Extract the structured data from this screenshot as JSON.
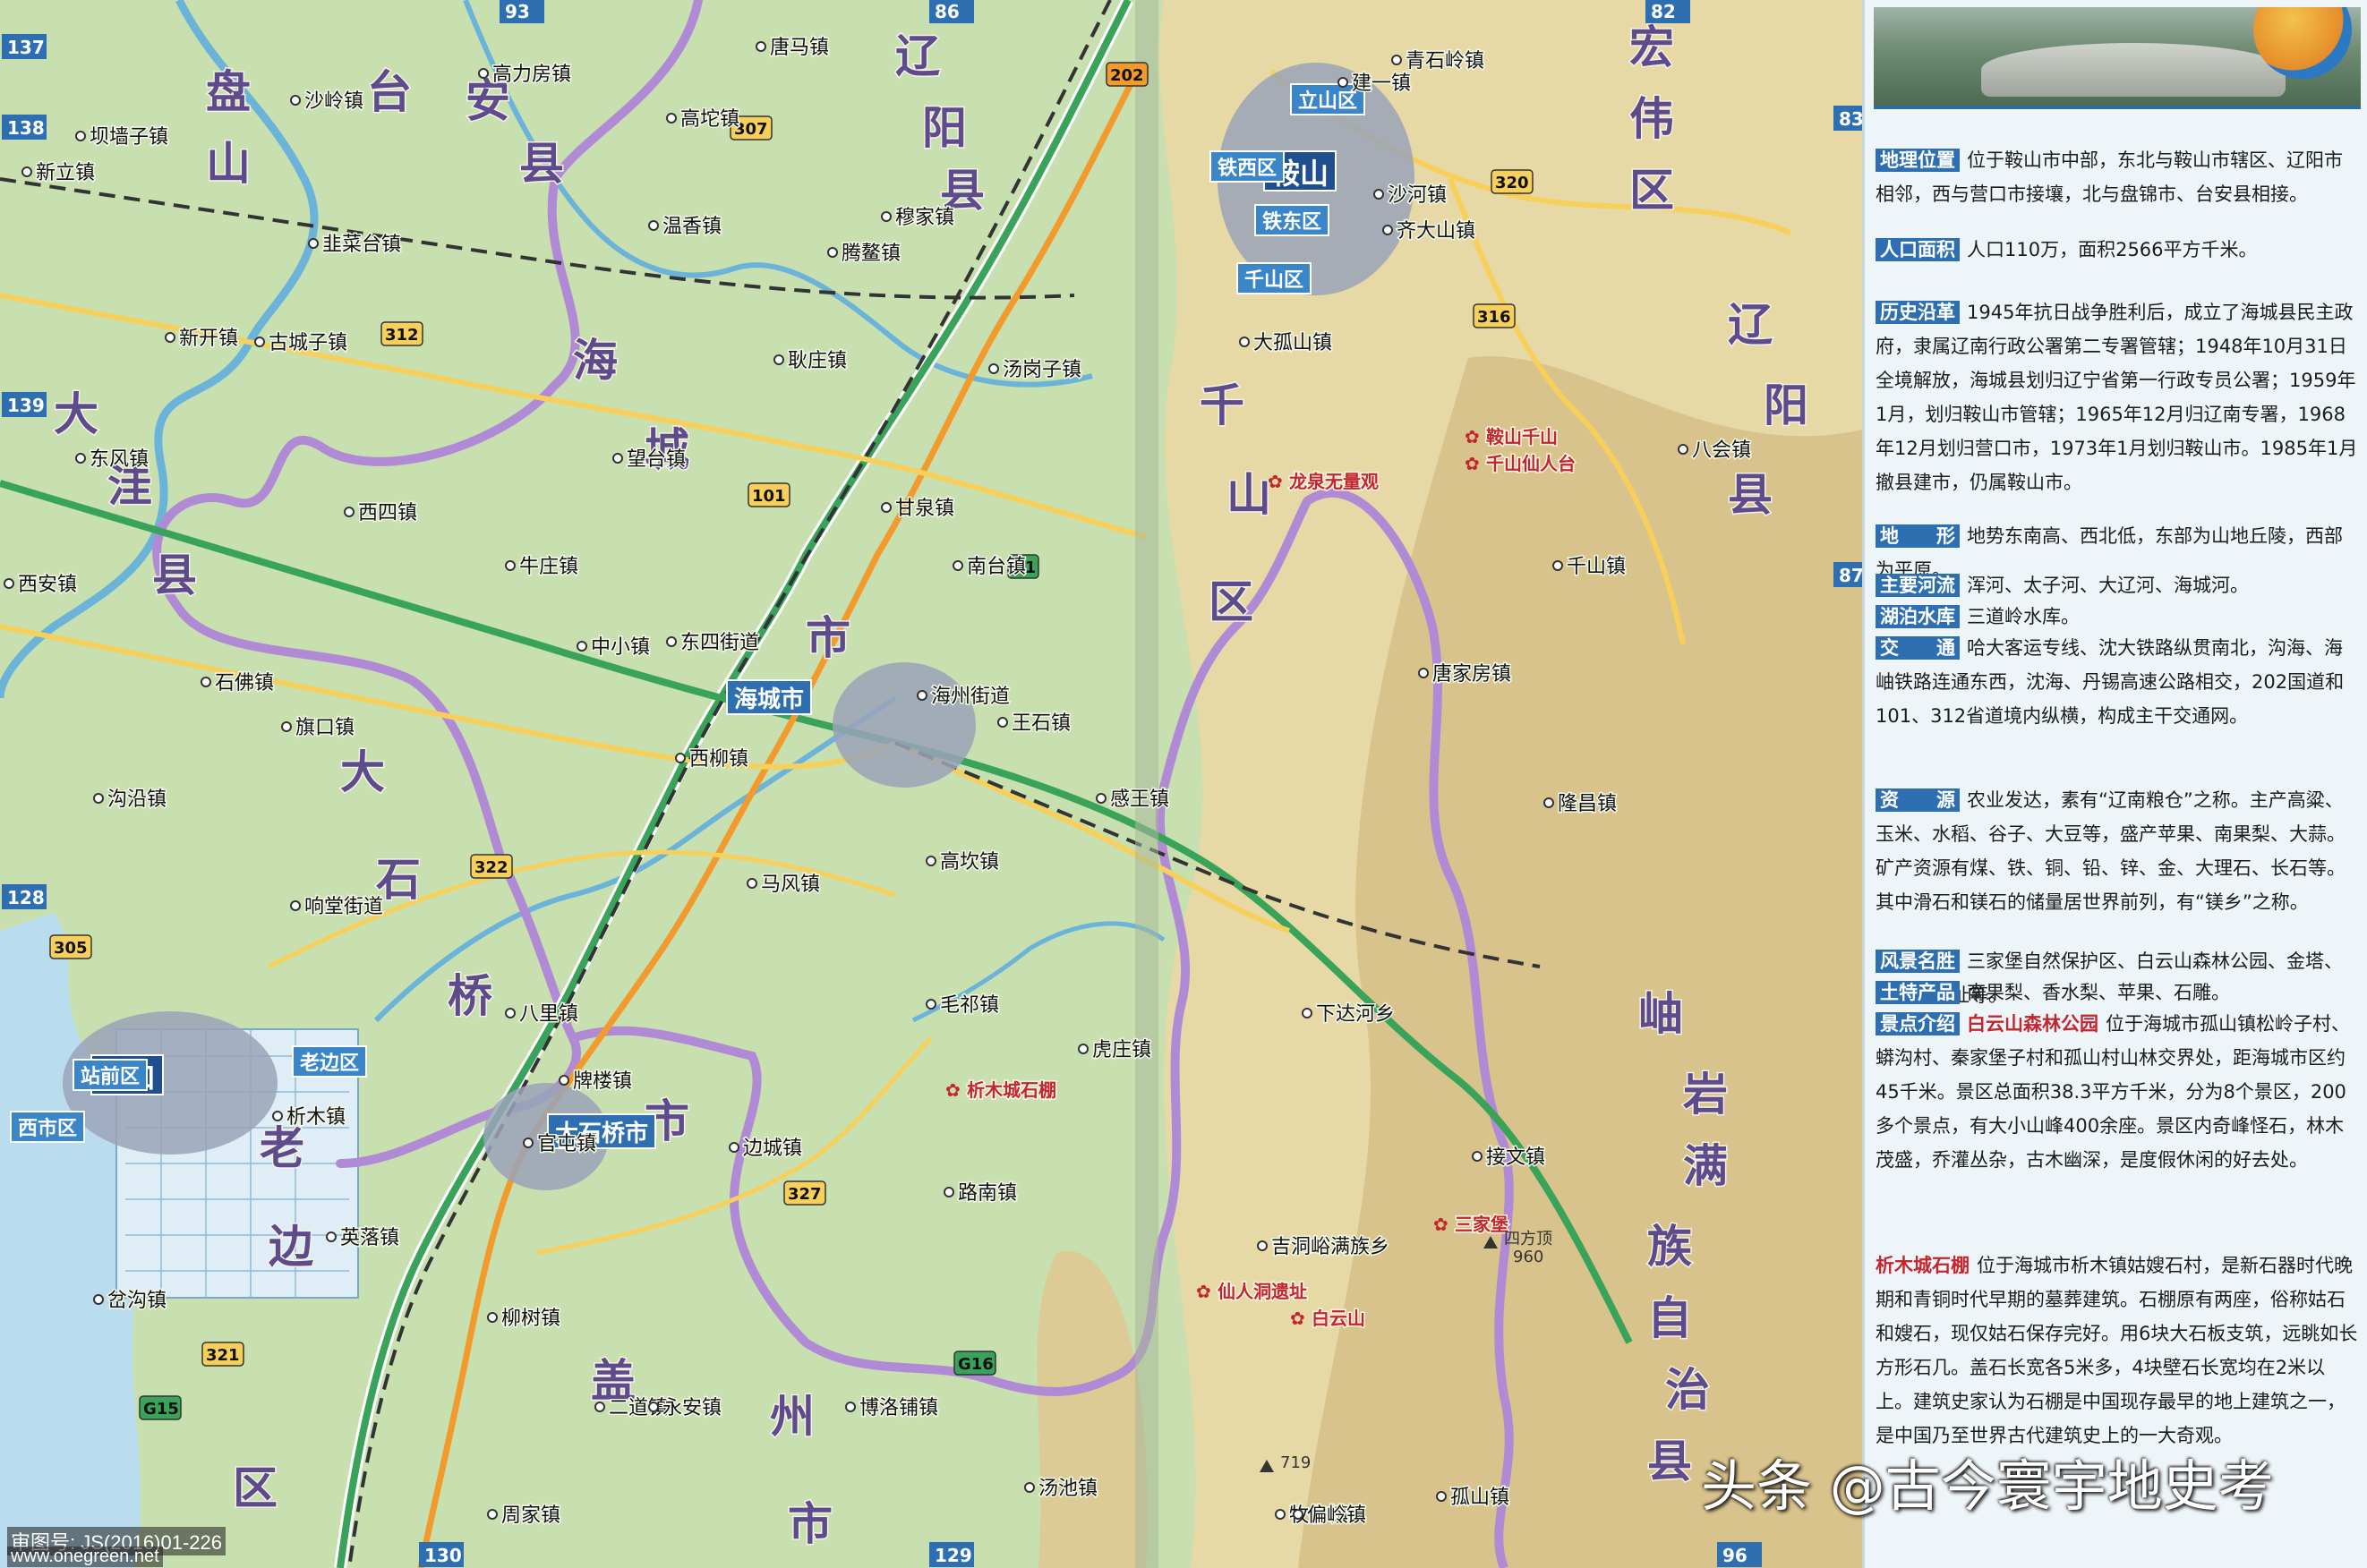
{
  "colors": {
    "plain": "#c8dfb0",
    "hill": "#e6d9a6",
    "mountain": "#d9c38c",
    "water": "#b9dcef",
    "city": "#9aa3b8",
    "border": "#b18ad6",
    "road_national": "#f29a2c",
    "road_provincial": "#f6d05a",
    "rail": "#333333",
    "label_blue": "#2d6fb0"
  },
  "page_numbers": [
    "93",
    "86",
    "82",
    "137",
    "138",
    "139",
    "128",
    "130",
    "129",
    "96",
    "83",
    "87"
  ],
  "route_shields": [
    "202",
    "307",
    "312",
    "101",
    "320",
    "316",
    "322",
    "305",
    "321",
    "327",
    "G15",
    "G16",
    "G1"
  ],
  "big_labels": [
    "盘",
    "山",
    "台",
    "安",
    "县",
    "辽",
    "阳",
    "县",
    "宏",
    "伟",
    "区",
    "大",
    "洼",
    "县",
    "海",
    "城",
    "市",
    "千",
    "山",
    "区",
    "辽",
    "阳",
    "县",
    "岫",
    "岩",
    "满",
    "族",
    "自",
    "治",
    "县",
    "大",
    "石",
    "桥",
    "市",
    "老",
    "边",
    "区",
    "盖",
    "州",
    "市"
  ],
  "cities": [
    {
      "name": "鞍山",
      "kind": "city"
    },
    {
      "name": "海城市",
      "kind": "county"
    },
    {
      "name": "营口",
      "kind": "city"
    },
    {
      "name": "大石桥市",
      "kind": "county"
    }
  ],
  "districts": [
    "立山区",
    "铁西区",
    "铁东区",
    "千山区",
    "站前区",
    "老边区",
    "西市区"
  ],
  "towns": [
    "唐马镇",
    "高力房镇",
    "沙岭镇",
    "高坨镇",
    "穆家镇",
    "新立镇",
    "坝墙子镇",
    "韭菜台镇",
    "温香镇",
    "腾鳌镇",
    "新开镇",
    "古城子镇",
    "耿庄镇",
    "汤岗子镇",
    "东风镇",
    "西四镇",
    "望台镇",
    "牛庄镇",
    "甘泉镇",
    "西安镇",
    "南台镇",
    "中小镇",
    "东四街道",
    "石佛镇",
    "旗口镇",
    "海州街道",
    "王石镇",
    "沟沿镇",
    "西柳镇",
    "感王镇",
    "响堂街道",
    "马风镇",
    "高坎镇",
    "毛祁镇",
    "八里镇",
    "牌楼镇",
    "虎庄镇",
    "官屯镇",
    "析木镇",
    "边城镇",
    "路南镇",
    "英落镇",
    "岔沟镇",
    "柳树镇",
    "二道镇",
    "永安镇",
    "博洛铺镇",
    "汤池镇",
    "周家镇",
    "建一镇",
    "青石岭镇",
    "沙河镇",
    "齐大山镇",
    "大孤山镇",
    "千山镇",
    "唐家房镇",
    "八会镇",
    "隆昌镇",
    "下达河乡",
    "吉洞峪满族乡",
    "接文镇",
    "孤山镇",
    "牧牛镇",
    "偏岭镇"
  ],
  "scenic_labels": [
    "鞍山千山",
    "千山仙人台",
    "龙泉无量观",
    "析木城石棚",
    "仙人洞遗址",
    "白云山",
    "三家堡"
  ],
  "peaks": [
    "四方顶",
    "960",
    "719"
  ],
  "info": {
    "entries": [
      {
        "label": "地理位置",
        "text": "位于鞍山市中部，东北与鞍山市辖区、辽阳市相邻，西与营口市接壤，北与盘锦市、台安县相接。"
      },
      {
        "label": "人口面积",
        "text": "人口110万，面积2566平方千米。"
      },
      {
        "label": "历史沿革",
        "text": "1945年抗日战争胜利后，成立了海城县民主政府，隶属辽南行政公署第二专署管辖；1948年10月31日全境解放，海城县划归辽宁省第一行政专员公署；1959年1月，划归鞍山市管辖；1965年12月归辽南专署，1968年12月划归营口市，1973年1月划归鞍山市。1985年1月撤县建市，仍属鞍山市。"
      },
      {
        "label": "地　　形",
        "text": "地势东南高、西北低，东部为山地丘陵，西部为平原。"
      },
      {
        "label": "主要河流",
        "text": "浑河、太子河、大辽河、海城河。"
      },
      {
        "label": "湖泊水库",
        "text": "三道岭水库。"
      },
      {
        "label": "交　　通",
        "text": "哈大客运专线、沈大铁路纵贯南北，沟海、海岫铁路连通东西，沈海、丹锡高速公路相交，202国道和101、312省道境内纵横，构成主干交通网。"
      },
      {
        "label": "资　　源",
        "text": "农业发达，素有“辽南粮仓”之称。主产高粱、玉米、水稻、谷子、大豆等，盛产苹果、南果梨、大蒜。矿产资源有煤、铁、铜、铅、锌、金、大理石、长石等。其中滑石和镁石的储量居世界前列，有“镁乡”之称。"
      },
      {
        "label": "风景名胜",
        "text": "三家堡自然保护区、白云山森林公园、金塔、仙人洞遗址等。"
      },
      {
        "label": "土特产品",
        "text": "南果梨、香水梨、苹果、石雕。"
      },
      {
        "label": "景点介绍",
        "sub": "白云山森林公园",
        "text": "位于海城市孤山镇松岭子村、蟒沟村、秦家堡子村和孤山村山林交界处，距海城市区约45千米。景区总面积38.3平方千米，分为8个景区，200多个景点，有大小山峰400余座。景区内奇峰怪石，林木茂盛，乔灌丛杂，古木幽深，是度假休闲的好去处。"
      },
      {
        "label": "",
        "sub": "析木城石棚",
        "text": "位于海城市析木镇姑嫂石村，是新石器时代晚期和青铜时代早期的墓葬建筑。石棚原有两座，俗称姑石和嫂石，现仅姑石保存完好。用6块大石板支筑，远眺如长方形石几。盖石长宽各5米多，4块壁石长宽均在2米以上。建筑史家认为石棚是中国现存最早的地上建筑之一，是中国乃至世界古代建筑史上的一大奇观。"
      }
    ]
  },
  "watermark": "头条 @古今寰宇地史考",
  "map_number": "审图号: JS(2016)01-226",
  "site_url": "www.onegreen.net"
}
